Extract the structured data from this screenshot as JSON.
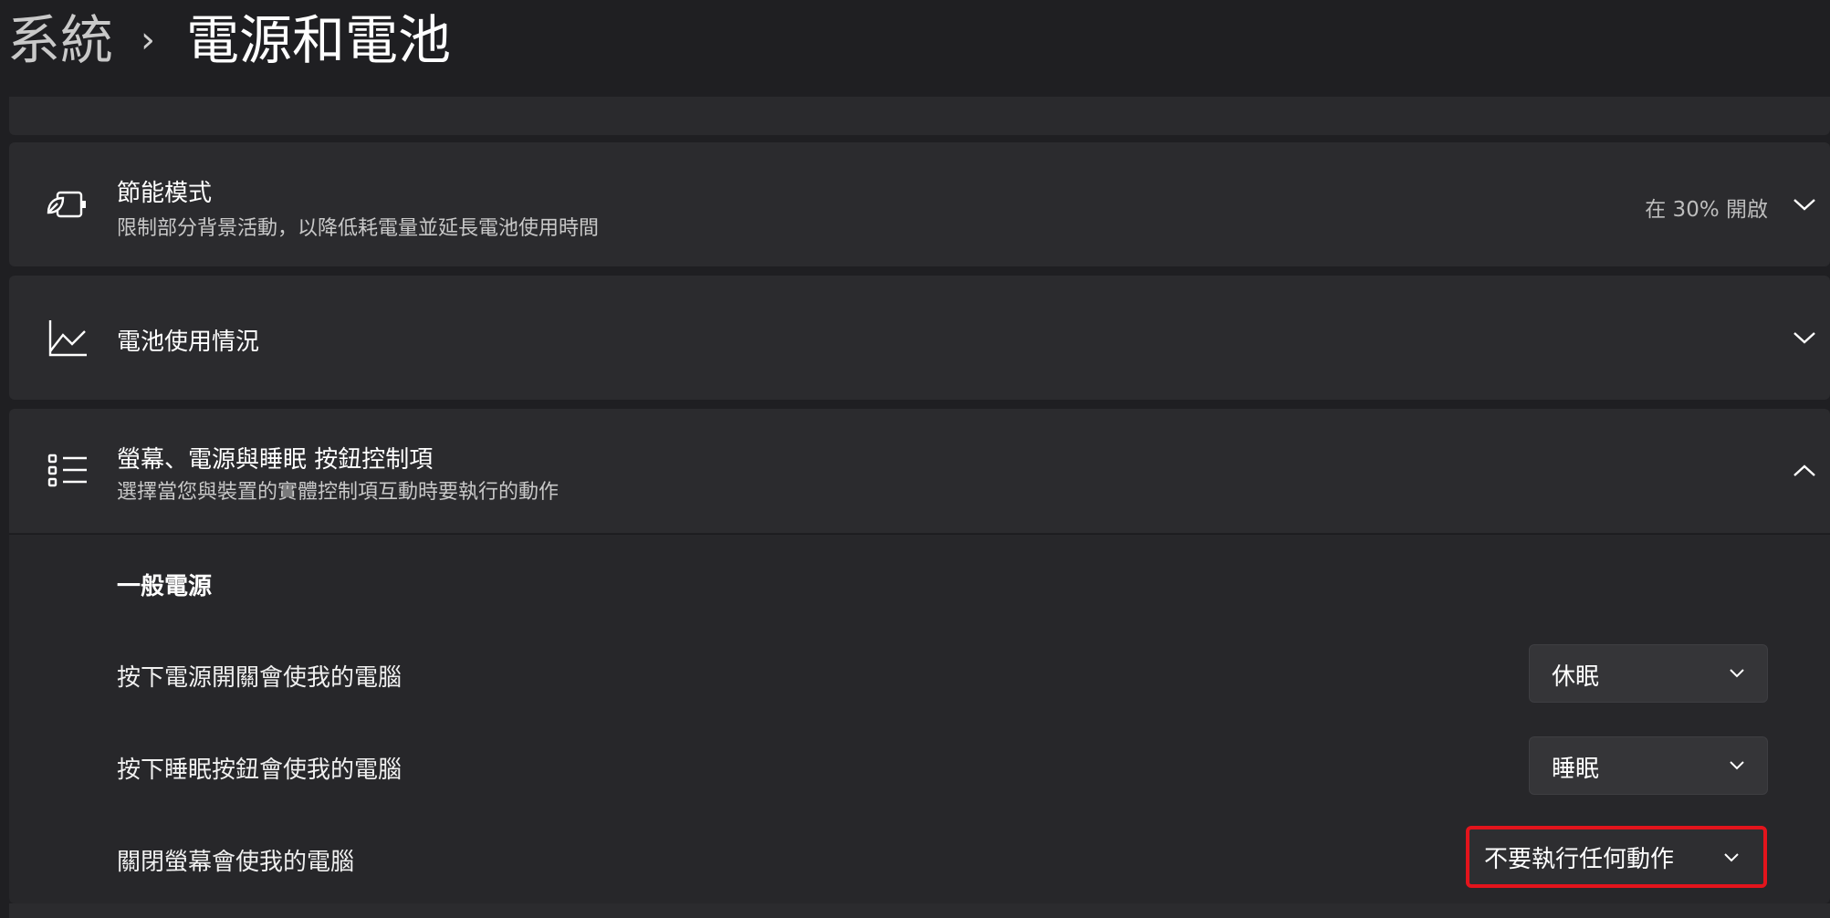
{
  "header": {
    "parent": "系統",
    "separator": "›",
    "current": "電源和電池"
  },
  "energy_saver": {
    "icon": "leaf-battery-icon",
    "title": "節能模式",
    "subtitle": "限制部分背景活動，以降低耗電量並延長電池使用時間",
    "status": "在 30% 開啟"
  },
  "battery_usage": {
    "icon": "line-chart-icon",
    "title": "電池使用情況"
  },
  "power_buttons": {
    "icon": "list-icon",
    "title": "螢幕、電源與睡眠 按鈕控制項",
    "subtitle": "選擇當您與裝置的實體控制項互動時要執行的動作",
    "section_heading": "一般電源",
    "rows": [
      {
        "label": "按下電源開關會使我的電腦",
        "value": "休眠"
      },
      {
        "label": "按下睡眠按鈕會使我的電腦",
        "value": "睡眠"
      },
      {
        "label": "關閉螢幕會使我的電腦",
        "value": "不要執行任何動作"
      }
    ]
  },
  "colors": {
    "background": "#1f1f22",
    "card": "#2b2b2e",
    "highlight_border": "#e3141c"
  }
}
